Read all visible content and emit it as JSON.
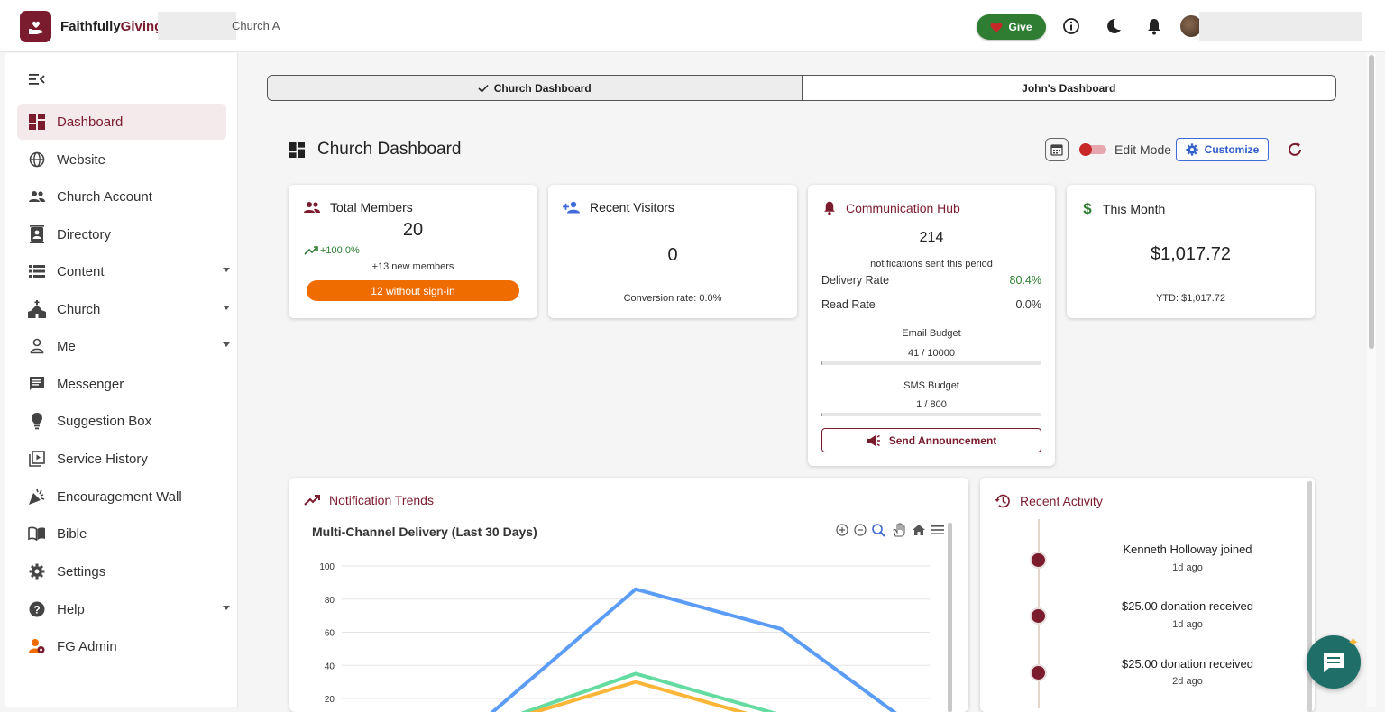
{
  "header": {
    "brand_part1": "Faithfully",
    "brand_part2": "Giving",
    "church_name": "Church A",
    "give_label": "Give",
    "accent": "#7b1c2e"
  },
  "sidebar": {
    "items": [
      {
        "label": "Dashboard",
        "icon": "dashboard-icon"
      },
      {
        "label": "Website",
        "icon": "globe-icon"
      },
      {
        "label": "Church Account",
        "icon": "people-icon"
      },
      {
        "label": "Directory",
        "icon": "contact-book-icon"
      },
      {
        "label": "Content",
        "icon": "list-icon"
      },
      {
        "label": "Church",
        "icon": "church-icon"
      },
      {
        "label": "Me",
        "icon": "person-icon"
      },
      {
        "label": "Messenger",
        "icon": "message-icon"
      },
      {
        "label": "Suggestion Box",
        "icon": "lightbulb-icon"
      },
      {
        "label": "Service History",
        "icon": "video-library-icon"
      },
      {
        "label": "Encouragement Wall",
        "icon": "celebration-icon"
      },
      {
        "label": "Bible",
        "icon": "book-icon"
      },
      {
        "label": "Settings",
        "icon": "gear-icon"
      },
      {
        "label": "Help",
        "icon": "help-icon"
      },
      {
        "label": "FG Admin",
        "icon": "admin-icon"
      }
    ]
  },
  "tabs": {
    "church": "Church Dashboard",
    "john": "John's Dashboard"
  },
  "page": {
    "title": "Church Dashboard",
    "edit_mode": "Edit Mode",
    "customize": "Customize"
  },
  "cards": {
    "total_members": {
      "title": "Total Members",
      "value": "20",
      "trend": "+100.0%",
      "new_members": "+13 new members",
      "without_signin": "12 without sign-in"
    },
    "recent_visitors": {
      "title": "Recent Visitors",
      "value": "0",
      "conversion": "Conversion rate: 0.0%"
    },
    "communication": {
      "title": "Communication Hub",
      "value": "214",
      "subtitle": "notifications sent this period",
      "delivery_label": "Delivery Rate",
      "delivery_value": "80.4%",
      "read_label": "Read Rate",
      "read_value": "0.0%",
      "email_label": "Email Budget",
      "email_value": "41 / 10000",
      "email_fraction": 0.0041,
      "sms_label": "SMS Budget",
      "sms_value": "1 / 800",
      "sms_fraction": 0.00125,
      "announce": "Send Announcement"
    },
    "this_month": {
      "title": "This Month",
      "value": "$1,017.72",
      "ytd": "YTD: $1,017.72"
    }
  },
  "notification_trends": {
    "title": "Notification Trends"
  },
  "chart_data": {
    "type": "line",
    "title": "Multi-Channel Delivery (Last 30 Days)",
    "yticks": [
      "100",
      "80",
      "60",
      "40",
      "20"
    ],
    "ylim": [
      0,
      100
    ],
    "series": [
      {
        "color": "#5b9cf6",
        "values": [
          0,
          86,
          62,
          0
        ]
      },
      {
        "color": "#64dba0",
        "values": [
          0,
          35,
          10,
          0
        ]
      },
      {
        "color": "#fbb537",
        "values": [
          0,
          30,
          5,
          0
        ]
      }
    ]
  },
  "recent_activity": {
    "title": "Recent Activity",
    "items": [
      {
        "text": "Kenneth Holloway joined",
        "time": "1d ago"
      },
      {
        "text": "$25.00 donation received",
        "time": "1d ago"
      },
      {
        "text": "$25.00 donation received",
        "time": "2d ago"
      }
    ]
  }
}
